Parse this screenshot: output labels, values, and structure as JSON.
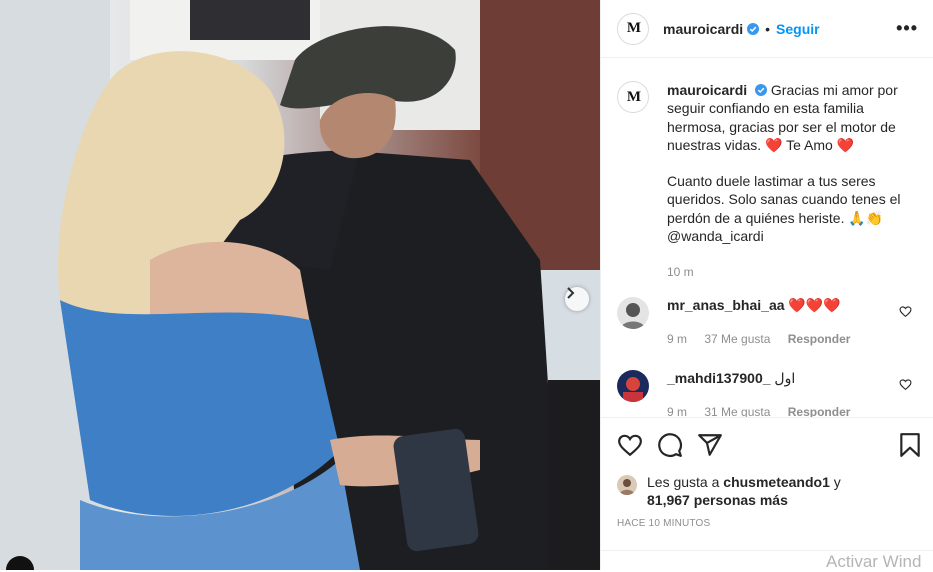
{
  "post": {
    "username": "mauroicardi",
    "follow_label": "Seguir",
    "separator": "•",
    "more_label": "•••",
    "avatar_text": "M"
  },
  "caption": {
    "username": "mauroicardi",
    "line1": "Gracias mi amor por seguir confiando en esta familia hermosa, gracias por ser el motor de nuestras vidas. ❤️ Te Amo ❤️",
    "line2": "Cuanto duele lastimar a tus seres queridos. Solo sanas cuando tenes el perdón de a quiénes heriste. 🙏👏 @wanda_icardi",
    "time": "10 m"
  },
  "comments": [
    {
      "username": "mr_anas_bhai_aa",
      "text": "❤️❤️❤️",
      "time": "9 m",
      "likes": "37 Me gusta",
      "reply": "Responder"
    },
    {
      "username": "_mahdi137900_",
      "text": "اول",
      "time": "9 m",
      "likes": "31 Me gusta",
      "reply": "Responder"
    }
  ],
  "likes": {
    "prefix": "Les gusta a",
    "user": "chusmeteando1",
    "mid": "y",
    "count": "81,967 personas más"
  },
  "timestamp": "HACE 10 MINUTOS",
  "watermark": "Activar Wind",
  "icons": {
    "like": "heart-icon",
    "comment": "comment-icon",
    "share": "share-icon",
    "save": "bookmark-icon",
    "next": "chevron-right-icon",
    "verified": "verified-badge-icon"
  },
  "colors": {
    "link": "#0095f6",
    "verified": "#3897f0",
    "heart": "#ed1c24",
    "muted": "#8e8e8e"
  }
}
